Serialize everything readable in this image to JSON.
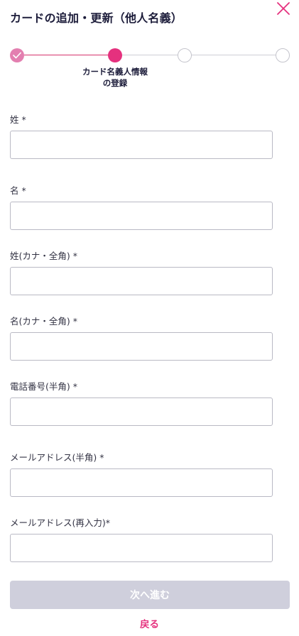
{
  "header": {
    "title": "カードの追加・更新（他人名義）",
    "close_icon": "close-icon"
  },
  "stepper": {
    "current_step_caption_line1": "カード名義人情報",
    "current_step_caption_line2": "の登録",
    "steps_total": 4,
    "current_step": 2,
    "colors": {
      "completed": "#e37fb0",
      "current": "#e5317e",
      "pending_border": "#c4c4cc"
    }
  },
  "form": {
    "fields": [
      {
        "label": "姓 *",
        "value": "",
        "placeholder": ""
      },
      {
        "label": "名 *",
        "value": "",
        "placeholder": ""
      },
      {
        "label": "姓(カナ・全角) *",
        "value": "",
        "placeholder": ""
      },
      {
        "label": "名(カナ・全角) *",
        "value": "",
        "placeholder": ""
      },
      {
        "label": "電話番号(半角) *",
        "value": "",
        "placeholder": ""
      },
      {
        "label": "メールアドレス(半角) *",
        "value": "",
        "placeholder": ""
      },
      {
        "label": "メールアドレス(再入力)*",
        "value": "",
        "placeholder": ""
      }
    ]
  },
  "actions": {
    "next_label": "次へ進む",
    "back_label": "戻る",
    "accent_color": "#e5317e",
    "disabled_button_color": "#cfcfdc"
  }
}
